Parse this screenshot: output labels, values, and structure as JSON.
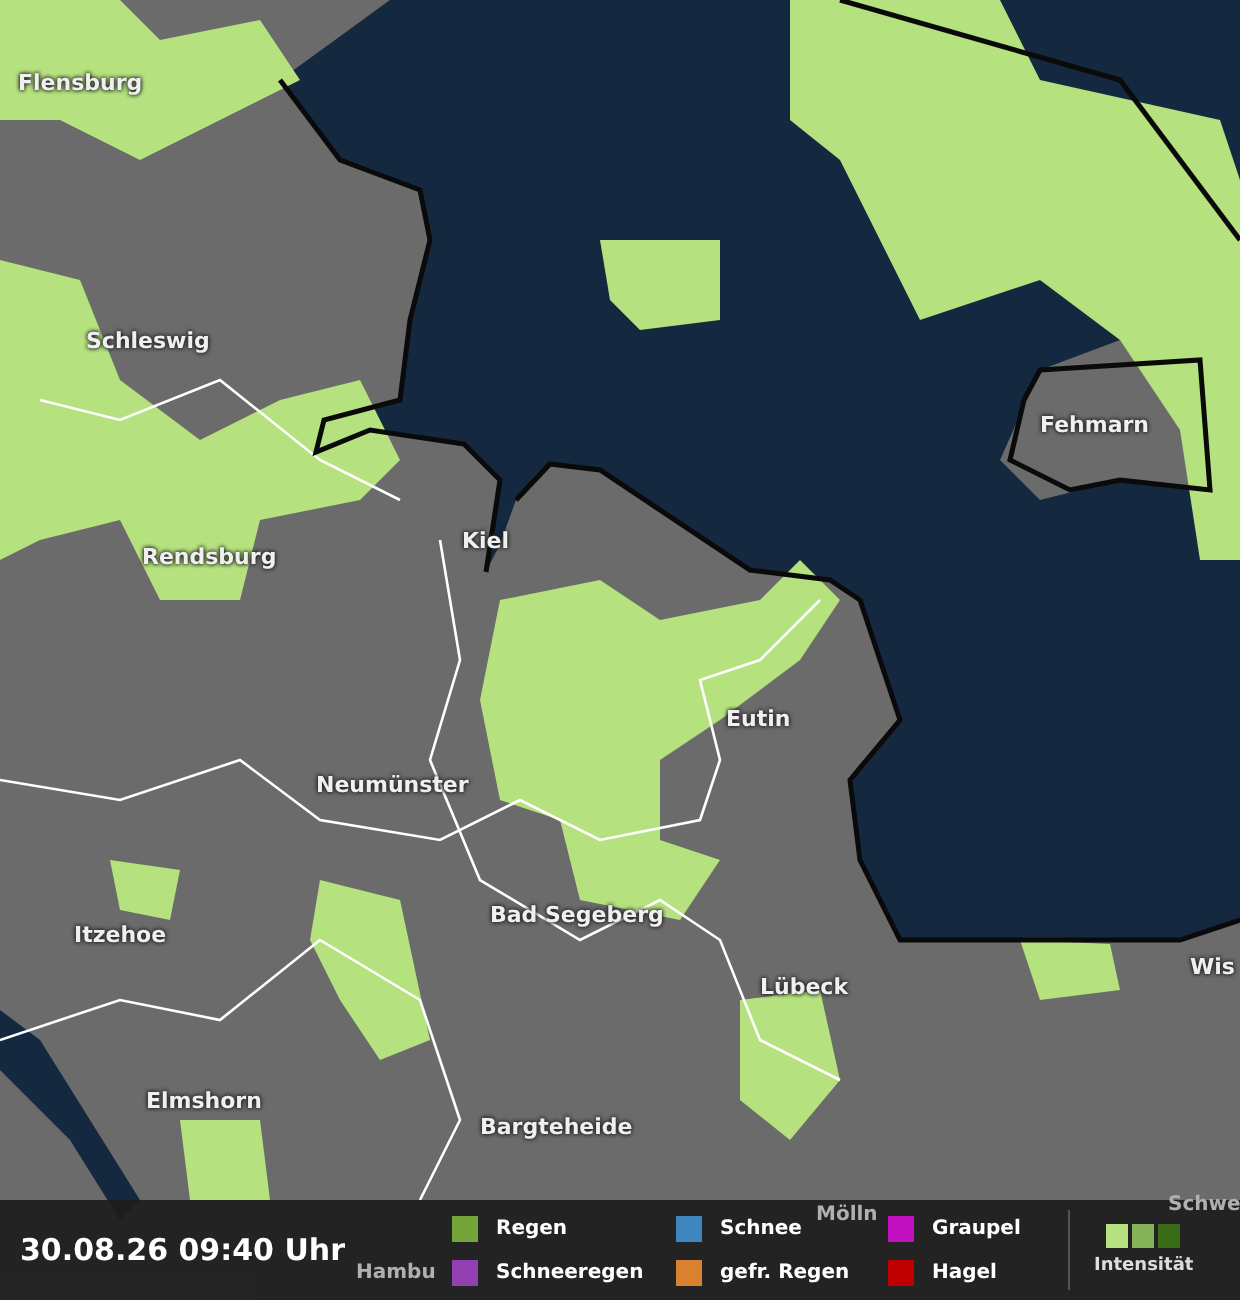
{
  "map": {
    "places": [
      {
        "name": "Flensburg"
      },
      {
        "name": "Schleswig"
      },
      {
        "name": "Rendsburg"
      },
      {
        "name": "Kiel"
      },
      {
        "name": "Fehmarn"
      },
      {
        "name": "Eutin"
      },
      {
        "name": "Neumünster"
      },
      {
        "name": "Itzehoe"
      },
      {
        "name": "Bad Segeberg"
      },
      {
        "name": "Lübeck"
      },
      {
        "name": "Wis"
      },
      {
        "name": "Elmshorn"
      },
      {
        "name": "Bargteheide"
      },
      {
        "name": "Mölln"
      },
      {
        "name": "Schwe"
      },
      {
        "name": "Hambu"
      }
    ]
  },
  "timestamp": "30.08.26 09:40 Uhr",
  "legend": {
    "items": [
      {
        "label": "Regen",
        "color": "#75a53a"
      },
      {
        "label": "Schneeregen",
        "color": "#9040b0"
      },
      {
        "label": "Schnee",
        "color": "#3d86c0"
      },
      {
        "label": "gefr. Regen",
        "color": "#d8822f"
      },
      {
        "label": "Graupel",
        "color": "#c010c0"
      },
      {
        "label": "Hagel",
        "color": "#c00000"
      }
    ],
    "intensity": {
      "label": "Intensität"
    }
  }
}
